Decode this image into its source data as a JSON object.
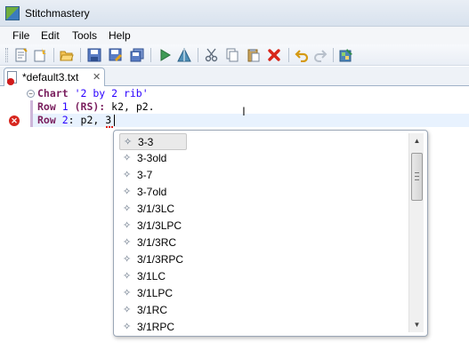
{
  "window": {
    "title": "Stitchmastery"
  },
  "menu": [
    {
      "label": "File"
    },
    {
      "label": "Edit"
    },
    {
      "label": "Tools"
    },
    {
      "label": "Help"
    }
  ],
  "toolbar": {
    "icons": [
      "new-chart-icon",
      "new-file-icon",
      "open-folder-icon",
      "save-icon",
      "save-as-icon",
      "save-all-icon",
      "run-icon",
      "chart-preview-icon",
      "cut-icon",
      "copy-icon",
      "paste-icon",
      "delete-icon",
      "undo-icon",
      "redo-icon",
      "palette-icon"
    ]
  },
  "tab": {
    "label": "*default3.txt",
    "close_glyph": "✕"
  },
  "editor": {
    "lines": [
      {
        "keyword": "Chart",
        "rest_string": "'2 by 2 rib'"
      },
      {
        "keyword": "Row",
        "number": "1",
        "paren": "(RS):",
        "rest": " k2, p2."
      },
      {
        "keyword": "Row",
        "number": "2",
        "colon": ":",
        "rest": " p2, ",
        "error_text": "3"
      }
    ],
    "fold_glyph": "−",
    "error_glyph": "✕",
    "ibeam_glyph": "I"
  },
  "autocomplete": {
    "items": [
      {
        "label": "3-3",
        "selected": true
      },
      {
        "label": "3-3old"
      },
      {
        "label": "3-7"
      },
      {
        "label": "3-7old"
      },
      {
        "label": "3/1/3LC"
      },
      {
        "label": "3/1/3LPC"
      },
      {
        "label": "3/1/3RC"
      },
      {
        "label": "3/1/3RPC"
      },
      {
        "label": "3/1LC"
      },
      {
        "label": "3/1LPC"
      },
      {
        "label": "3/1RC"
      },
      {
        "label": "3/1RPC"
      }
    ],
    "item_icon_glyph": "✧",
    "scroll_up_glyph": "▲",
    "scroll_down_glyph": "▼"
  },
  "colors": {
    "keyword": "#7a1f5e",
    "literal": "#2a00ff",
    "error": "#d7261e",
    "current_line": "#e8f2fe"
  }
}
